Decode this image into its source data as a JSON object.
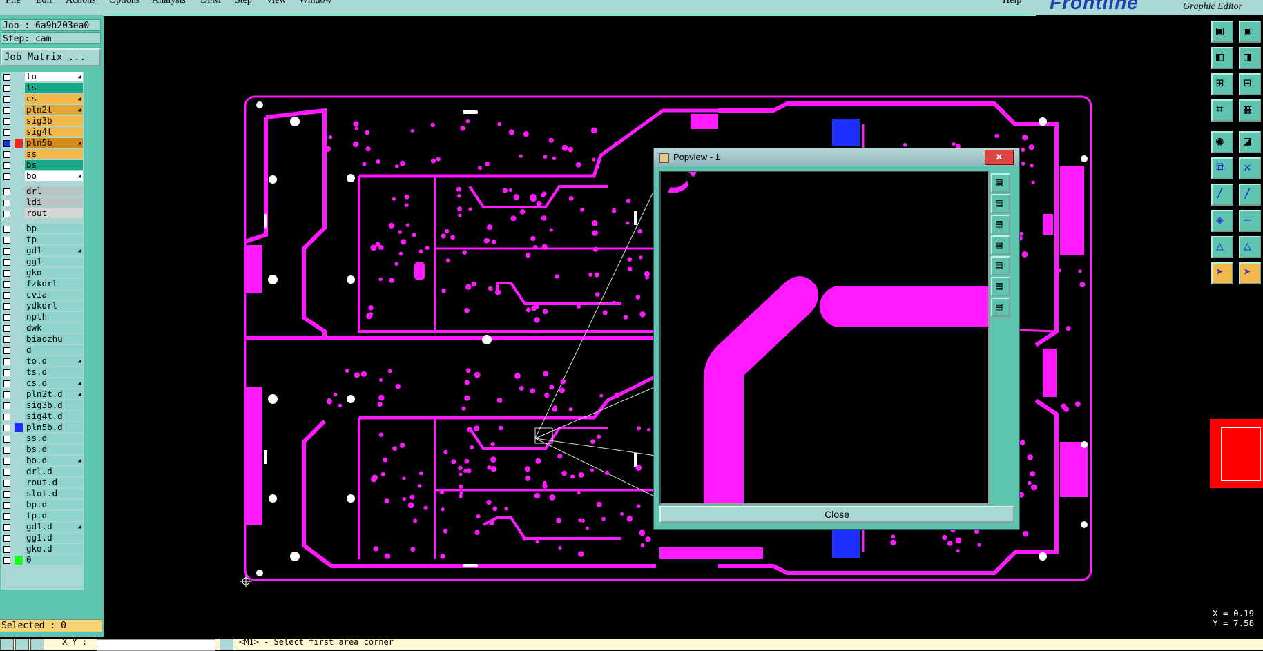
{
  "menubar": {
    "items": [
      "File",
      "Edit",
      "Actions",
      "Options",
      "Analysis",
      "DFM",
      "Step",
      "View",
      "Window"
    ],
    "help": "Help"
  },
  "brand": {
    "logo": "Frontline",
    "subtitle": "Graphic Editor"
  },
  "job": {
    "job_label": "Job : 6a9h203ea0",
    "step_label": "Step: cam",
    "matrix_button": "Job Matrix ..."
  },
  "layers": [
    {
      "name": "to",
      "color": "#ffffff",
      "arrow": true
    },
    {
      "name": "ts",
      "color": "#1aa88a",
      "arrow": false
    },
    {
      "name": "cs",
      "color": "#f2b94a",
      "arrow": true
    },
    {
      "name": "pln2t",
      "color": "#e6a633",
      "arrow": true
    },
    {
      "name": "sig3b",
      "color": "#f2b94a",
      "arrow": false
    },
    {
      "name": "sig4t",
      "color": "#f2b94a",
      "arrow": false
    },
    {
      "name": "pln5b",
      "color": "#d48b1a",
      "arrow": true,
      "swatch": "#ff2020",
      "checked": true
    },
    {
      "name": "ss",
      "color": "#f2b94a",
      "arrow": false
    },
    {
      "name": "bs",
      "color": "#1aa88a",
      "arrow": false
    },
    {
      "name": "bo",
      "color": "#ffffff",
      "arrow": true
    },
    {
      "name": "drl",
      "color": "#b9c3c4",
      "arrow": false
    },
    {
      "name": "ldi",
      "color": "#b9c3c4",
      "arrow": false
    },
    {
      "name": "rout",
      "color": "#d6d6d6",
      "arrow": false
    },
    {
      "name": "bp",
      "color": "#8fd3cf",
      "arrow": false
    },
    {
      "name": "tp",
      "color": "#8fd3cf",
      "arrow": false
    },
    {
      "name": "gd1",
      "color": "#8fd3cf",
      "arrow": true
    },
    {
      "name": "gg1",
      "color": "#8fd3cf",
      "arrow": false
    },
    {
      "name": "gko",
      "color": "#8fd3cf",
      "arrow": false
    },
    {
      "name": "fzkdrl",
      "color": "#8fd3cf",
      "arrow": false
    },
    {
      "name": "cvia",
      "color": "#8fd3cf",
      "arrow": false
    },
    {
      "name": "ydkdrl",
      "color": "#8fd3cf",
      "arrow": false
    },
    {
      "name": "npth",
      "color": "#8fd3cf",
      "arrow": false
    },
    {
      "name": "dwk",
      "color": "#8fd3cf",
      "arrow": false
    },
    {
      "name": "biaozhu",
      "color": "#8fd3cf",
      "arrow": false
    },
    {
      "name": "d",
      "color": "#8fd3cf",
      "arrow": false
    },
    {
      "name": "to.d",
      "color": "#8fd3cf",
      "arrow": true
    },
    {
      "name": "ts.d",
      "color": "#8fd3cf",
      "arrow": false
    },
    {
      "name": "cs.d",
      "color": "#8fd3cf",
      "arrow": true
    },
    {
      "name": "pln2t.d",
      "color": "#8fd3cf",
      "arrow": true
    },
    {
      "name": "sig3b.d",
      "color": "#8fd3cf",
      "arrow": false
    },
    {
      "name": "sig4t.d",
      "color": "#8fd3cf",
      "arrow": false
    },
    {
      "name": "pln5b.d",
      "color": "#8fd3cf",
      "arrow": false,
      "swatch": "#1f2fff"
    },
    {
      "name": "ss.d",
      "color": "#8fd3cf",
      "arrow": false
    },
    {
      "name": "bs.d",
      "color": "#8fd3cf",
      "arrow": false
    },
    {
      "name": "bo.d",
      "color": "#8fd3cf",
      "arrow": true
    },
    {
      "name": "drl.d",
      "color": "#8fd3cf",
      "arrow": false
    },
    {
      "name": "rout.d",
      "color": "#8fd3cf",
      "arrow": false
    },
    {
      "name": "slot.d",
      "color": "#8fd3cf",
      "arrow": false
    },
    {
      "name": "bp.d",
      "color": "#8fd3cf",
      "arrow": false
    },
    {
      "name": "tp.d",
      "color": "#8fd3cf",
      "arrow": false
    },
    {
      "name": "gd1.d",
      "color": "#8fd3cf",
      "arrow": true
    },
    {
      "name": "gg1.d",
      "color": "#8fd3cf",
      "arrow": false
    },
    {
      "name": "gko.d",
      "color": "#8fd3cf",
      "arrow": false
    },
    {
      "name": "0",
      "color": "#8fd3cf",
      "arrow": false,
      "swatch": "#1aff1a"
    }
  ],
  "status": {
    "selected": "Selected : 0",
    "xy_label": "X Y :",
    "message": "<M1> - Select first area corner"
  },
  "coords": {
    "x": "X = 0.19",
    "y": "Y = 7.58"
  },
  "popview": {
    "title": "Popview - 1",
    "close_label": "Close"
  },
  "colors": {
    "trace": "#ff1aff",
    "background": "#000000",
    "panel": "#5ec4b0",
    "panel_light": "#a9d7d3"
  },
  "icons": {
    "right_toolbar": [
      "zoom-home-icon",
      "zoom-fit-icon",
      "pan-left-icon",
      "pan-right-icon",
      "zoom-in-icon",
      "zoom-out-icon",
      "measure-icon",
      "grid-icon",
      "snap-icon",
      "color-icon",
      "net-icon",
      "cross-icon",
      "line-icon",
      "line2-icon",
      "shape-icon",
      "minus-icon",
      "triangle-icon",
      "triangle2-icon",
      "pointer-icon",
      "pointer2-icon"
    ],
    "popview_side": [
      "popview-copy-icon",
      "popview-up-icon",
      "popview-down-icon",
      "popview-left-icon",
      "popview-right-icon",
      "popview-fit-icon",
      "popview-center-icon"
    ]
  }
}
